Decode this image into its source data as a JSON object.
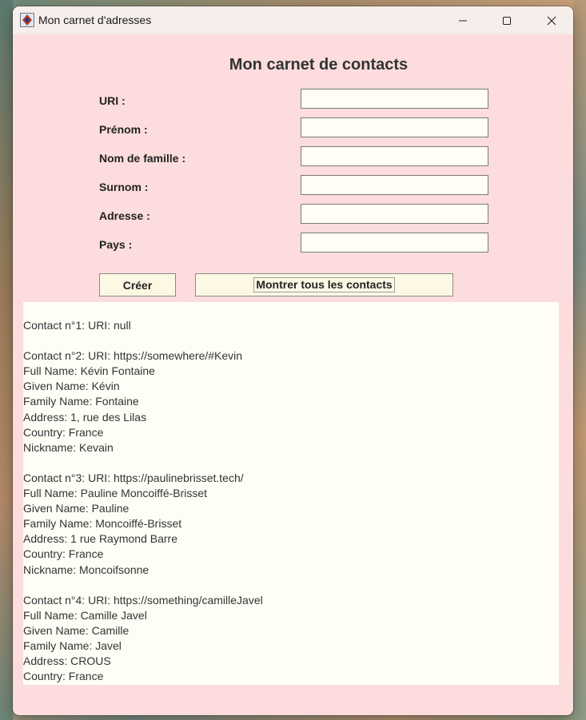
{
  "window": {
    "title": "Mon carnet d'adresses"
  },
  "form": {
    "heading": "Mon carnet de contacts",
    "fields": [
      {
        "label": "URI :",
        "value": ""
      },
      {
        "label": "Prénom :",
        "value": ""
      },
      {
        "label": "Nom de famille :",
        "value": ""
      },
      {
        "label": "Surnom :",
        "value": ""
      },
      {
        "label": "Adresse :",
        "value": ""
      },
      {
        "label": "Pays :",
        "value": ""
      }
    ],
    "create_label": "Créer",
    "show_all_label": "Montrer tous les contacts"
  },
  "output": {
    "lines": [
      "Contact n°1: URI: null",
      "",
      "Contact n°2: URI: https://somewhere/#Kevin",
      "Full Name: Kévin Fontaine",
      "Given Name: Kévin",
      "Family Name: Fontaine",
      "Address: 1, rue des Lilas",
      "Country: France",
      "Nickname: Kevain",
      "",
      "Contact n°3: URI: https://paulinebrisset.tech/",
      "Full Name: Pauline Moncoiffé-Brisset",
      "Given Name: Pauline",
      "Family Name: Moncoiffé-Brisset",
      "Address: 1 rue Raymond Barre",
      "Country: France",
      "Nickname: Moncoifsonne",
      "",
      "Contact n°4: URI: https://something/camilleJavel",
      "Full Name: Camille Javel",
      "Given Name: Camille",
      "Family Name: Javel",
      "Address: CROUS",
      "Country: France"
    ]
  },
  "colors": {
    "window_bg": "#fcdcdc",
    "titlebar_bg": "#f6eeeb",
    "input_bg": "#fffdf6",
    "button_bg": "#fdf8e4",
    "output_bg": "#fffef6"
  }
}
